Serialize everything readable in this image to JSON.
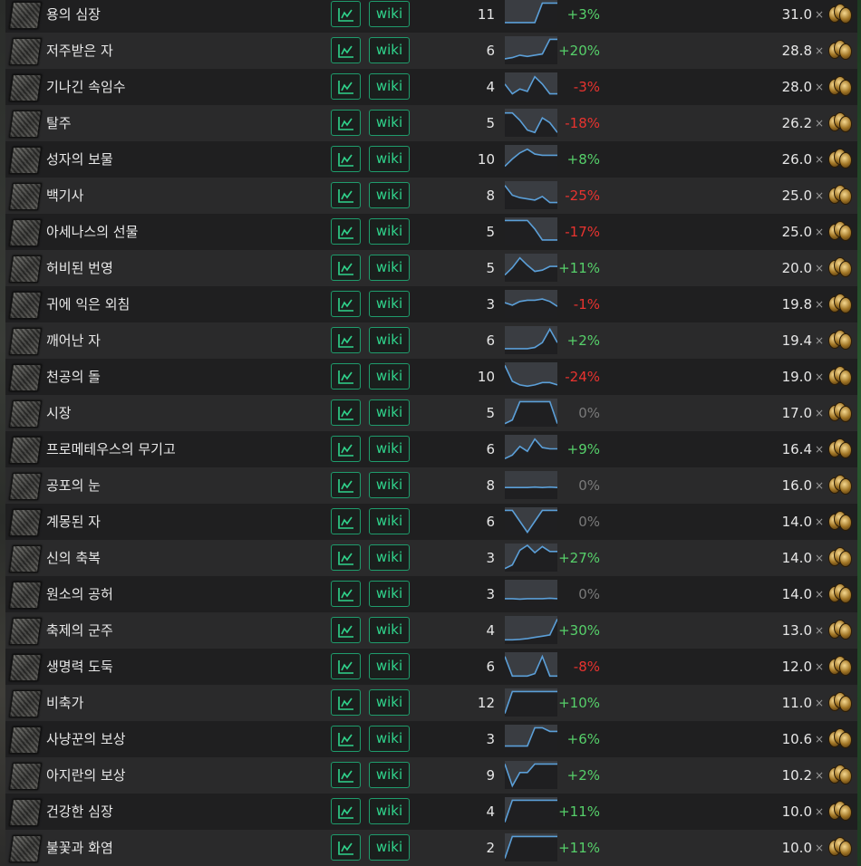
{
  "columns": {
    "chart_label": "chart",
    "wiki_label": "wiki",
    "times_symbol": "×",
    "currency_icon": "chaos-orb-icon"
  },
  "colors": {
    "positive": "#56d06a",
    "negative": "#e8332f",
    "neutral": "#7a7a7a",
    "accent": "#30d48c"
  },
  "rows": [
    {
      "name": "용의 심장",
      "count": "11",
      "change": "+3%",
      "trend": "pos",
      "price": "31.0",
      "spark": [
        0.15,
        0.15,
        0.15,
        0.15,
        0.15,
        0.95,
        0.95,
        0.95
      ]
    },
    {
      "name": "저주받은 자",
      "count": "6",
      "change": "+20%",
      "trend": "pos",
      "price": "28.8",
      "spark": [
        0.15,
        0.2,
        0.3,
        0.25,
        0.3,
        0.35,
        0.95,
        0.95
      ]
    },
    {
      "name": "기나긴 속임수",
      "count": "4",
      "change": "-3%",
      "trend": "neg",
      "price": "28.0",
      "spark": [
        0.6,
        0.2,
        0.4,
        0.3,
        0.9,
        0.6,
        0.2,
        0.2
      ]
    },
    {
      "name": "탈주",
      "count": "5",
      "change": "-18%",
      "trend": "neg",
      "price": "26.2",
      "spark": [
        0.9,
        0.9,
        0.6,
        0.2,
        0.1,
        0.7,
        0.5,
        0.1
      ]
    },
    {
      "name": "성자의 보물",
      "count": "10",
      "change": "+8%",
      "trend": "pos",
      "price": "26.0",
      "spark": [
        0.2,
        0.5,
        0.75,
        0.9,
        0.7,
        0.65,
        0.65,
        0.65
      ]
    },
    {
      "name": "백기사",
      "count": "8",
      "change": "-25%",
      "trend": "neg",
      "price": "25.0",
      "spark": [
        0.9,
        0.5,
        0.4,
        0.35,
        0.3,
        0.45,
        0.2,
        0.2
      ]
    },
    {
      "name": "아세나스의 선물",
      "count": "5",
      "change": "-17%",
      "trend": "neg",
      "price": "25.0",
      "spark": [
        0.95,
        0.95,
        0.95,
        0.95,
        0.6,
        0.15,
        0.15,
        0.15
      ]
    },
    {
      "name": "허비된 번영",
      "count": "5",
      "change": "+11%",
      "trend": "pos",
      "price": "20.0",
      "spark": [
        0.2,
        0.5,
        0.9,
        0.6,
        0.35,
        0.4,
        0.55,
        0.55
      ]
    },
    {
      "name": "귀에 익은 외침",
      "count": "3",
      "change": "-1%",
      "trend": "neg",
      "price": "19.8",
      "spark": [
        0.55,
        0.45,
        0.6,
        0.65,
        0.65,
        0.7,
        0.6,
        0.4
      ]
    },
    {
      "name": "깨어난 자",
      "count": "6",
      "change": "+2%",
      "trend": "pos",
      "price": "19.4",
      "spark": [
        0.15,
        0.15,
        0.15,
        0.15,
        0.2,
        0.4,
        0.95,
        0.4
      ]
    },
    {
      "name": "천공의 돌",
      "count": "10",
      "change": "-24%",
      "trend": "neg",
      "price": "19.0",
      "spark": [
        0.95,
        0.3,
        0.15,
        0.1,
        0.15,
        0.25,
        0.25,
        0.15
      ]
    },
    {
      "name": "시장",
      "count": "5",
      "change": "0%",
      "trend": "neutral",
      "price": "17.0",
      "spark": [
        0.05,
        0.2,
        0.95,
        0.95,
        0.95,
        0.95,
        0.95,
        0.05
      ]
    },
    {
      "name": "프로메테우스의 무기고",
      "count": "6",
      "change": "+9%",
      "trend": "pos",
      "price": "16.4",
      "spark": [
        0.1,
        0.25,
        0.6,
        0.4,
        0.9,
        0.55,
        0.5,
        0.5
      ]
    },
    {
      "name": "공포의 눈",
      "count": "8",
      "change": "0%",
      "trend": "neutral",
      "price": "16.0",
      "spark": [
        0.4,
        0.4,
        0.4,
        0.4,
        0.42,
        0.4,
        0.42,
        0.4
      ]
    },
    {
      "name": "계몽된 자",
      "count": "6",
      "change": "0%",
      "trend": "neutral",
      "price": "14.0",
      "spark": [
        0.95,
        0.95,
        0.5,
        0.05,
        0.5,
        0.95,
        0.95,
        0.95
      ]
    },
    {
      "name": "신의 축복",
      "count": "3",
      "change": "+27%",
      "trend": "pos",
      "price": "14.0",
      "spark": [
        0.05,
        0.2,
        0.8,
        1.0,
        0.7,
        0.95,
        0.75,
        0.75
      ]
    },
    {
      "name": "원소의 공허",
      "count": "3",
      "change": "0%",
      "trend": "neutral",
      "price": "14.0",
      "spark": [
        0.3,
        0.3,
        0.28,
        0.3,
        0.3,
        0.3,
        0.32,
        0.3
      ]
    },
    {
      "name": "축제의 군주",
      "count": "4",
      "change": "+30%",
      "trend": "pos",
      "price": "13.0",
      "spark": [
        0.1,
        0.1,
        0.12,
        0.15,
        0.2,
        0.25,
        0.3,
        0.95
      ]
    },
    {
      "name": "생명력 도둑",
      "count": "6",
      "change": "-8%",
      "trend": "neg",
      "price": "12.0",
      "spark": [
        0.9,
        0.1,
        0.1,
        0.1,
        0.2,
        0.9,
        0.1,
        0.1
      ]
    },
    {
      "name": "비축가",
      "count": "12",
      "change": "+10%",
      "trend": "pos",
      "price": "11.0",
      "spark": [
        0.05,
        0.95,
        0.95,
        0.95,
        0.95,
        0.95,
        0.95,
        0.95
      ]
    },
    {
      "name": "사냥꾼의 보상",
      "count": "3",
      "change": "+6%",
      "trend": "pos",
      "price": "10.6",
      "spark": [
        0.2,
        0.2,
        0.2,
        0.2,
        0.95,
        0.95,
        0.8,
        0.8
      ]
    },
    {
      "name": "아지란의 보상",
      "count": "9",
      "change": "+2%",
      "trend": "pos",
      "price": "10.2",
      "spark": [
        0.95,
        0.05,
        0.6,
        0.6,
        0.95,
        0.95,
        0.95,
        0.95
      ]
    },
    {
      "name": "건강한 심장",
      "count": "4",
      "change": "+11%",
      "trend": "pos",
      "price": "10.0",
      "spark": [
        0.05,
        0.95,
        0.95,
        0.95,
        0.95,
        0.95,
        0.95,
        0.95
      ]
    },
    {
      "name": "불꽃과 화염",
      "count": "2",
      "change": "+11%",
      "trend": "pos",
      "price": "10.0",
      "spark": [
        0.05,
        0.95,
        0.95,
        0.95,
        0.95,
        0.95,
        0.95,
        0.95
      ]
    }
  ]
}
